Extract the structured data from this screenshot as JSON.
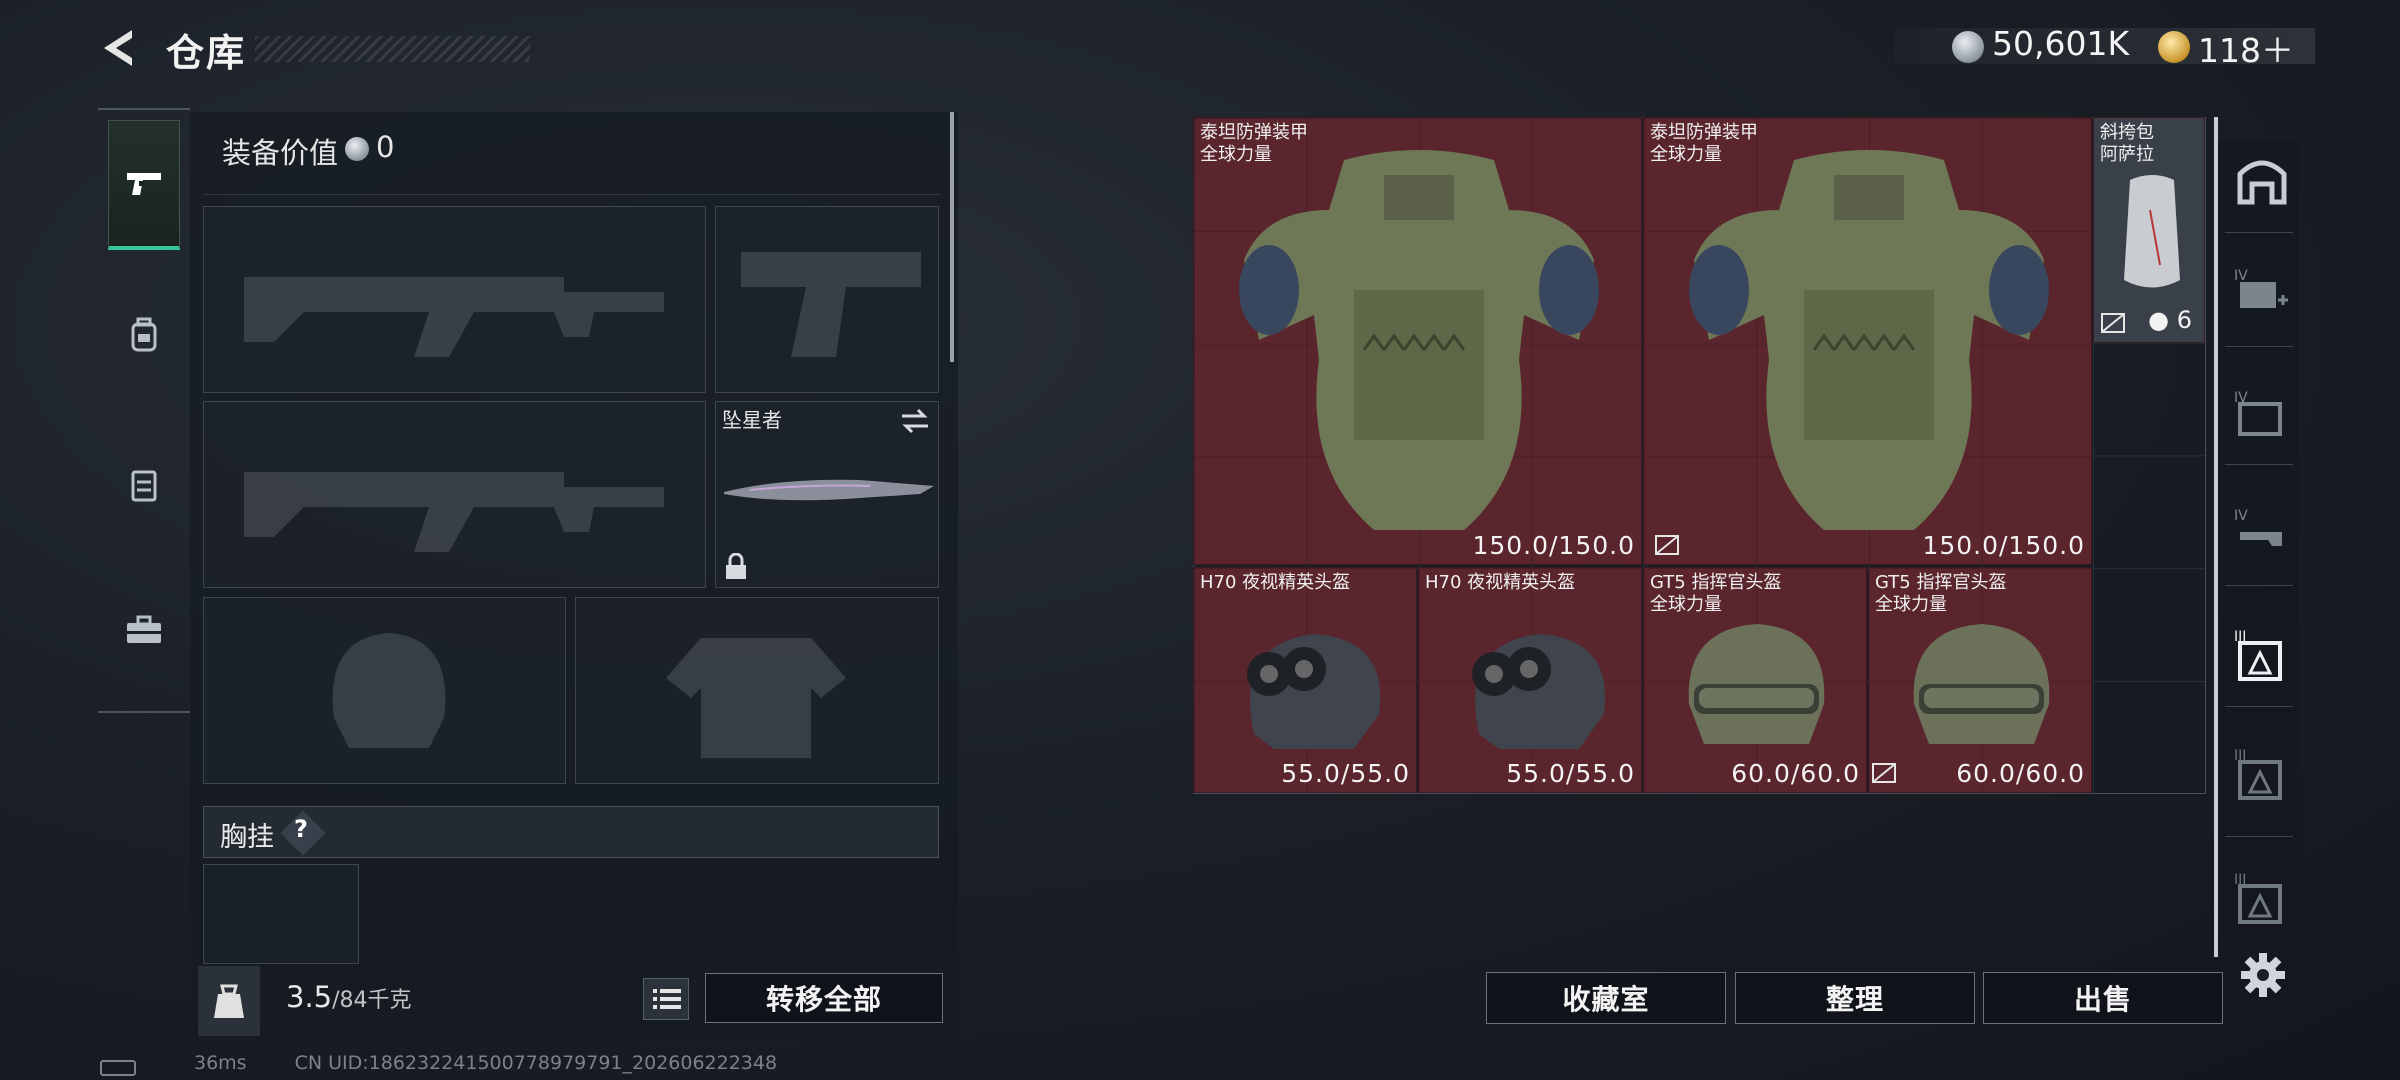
{
  "header": {
    "title": "仓库",
    "currency_1": "50,601K",
    "currency_2": "118＋"
  },
  "left_tabs": [
    "weapon-tab",
    "backpack-tab",
    "rig-tab",
    "toolbox-tab"
  ],
  "equipment": {
    "value_label": "装备价值",
    "value": "0",
    "melee_name": "坠星者",
    "chest_label": "胸挂",
    "chest_help": "?",
    "weight": "3.5",
    "weight_unit": "/84千克",
    "transfer_label": "转移全部"
  },
  "status": {
    "ping": "36ms",
    "uid": "CN UID:18623224150077897979​1_202606222348"
  },
  "storage": {
    "items": [
      {
        "name": "泰坦防弹装甲\n全球力量",
        "durability": "150.0/150.0",
        "type": "armor"
      },
      {
        "name": "泰坦防弹装甲\n全球力量",
        "durability": "150.0/150.0",
        "type": "armor"
      },
      {
        "name": "斜挎包\n阿萨拉",
        "count": "6",
        "type": "bag"
      },
      {
        "name": "H70 夜视精英头盔",
        "durability": "55.0/55.0",
        "type": "helmet-nv"
      },
      {
        "name": "H70 夜视精英头盔",
        "durability": "55.0/55.0",
        "type": "helmet-nv"
      },
      {
        "name": "GT5 指挥官头盔\n全球力量",
        "durability": "60.0/60.0",
        "type": "helmet-gt"
      },
      {
        "name": "GT5 指挥官头盔\n全球力量",
        "durability": "60.0/60.0",
        "type": "helmet-gt"
      }
    ],
    "cell_color": "#5a252c"
  },
  "buttons": {
    "collection": "收藏室",
    "sort": "整理",
    "sell": "出售"
  },
  "right_side_levels": [
    "IV",
    "IV",
    "IV",
    "III",
    "III",
    "III"
  ]
}
